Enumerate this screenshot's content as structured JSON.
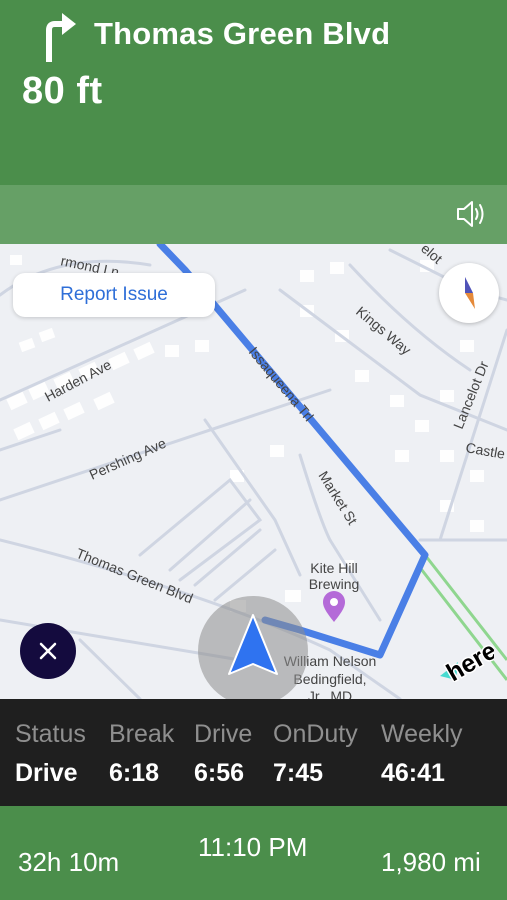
{
  "navigation": {
    "maneuver_icon": "turn-right-arrow-icon",
    "street_name": "Thomas Green Blvd",
    "distance": "80 ft"
  },
  "audio": {
    "icon": "speaker-icon"
  },
  "map": {
    "report_issue_label": "Report Issue",
    "compass_icon": "compass-icon",
    "close_icon": "close-icon",
    "logo_text": "here",
    "route_color": "#4a7fe6",
    "streets": {
      "ormond": "rmond Ln",
      "harden": "Harden Ave",
      "pershing": "Pershing Ave",
      "issaqueena": "Issaqueena Trl",
      "kings_way": "Kings Way",
      "lancelot": "Lancelot Dr",
      "castle": "Castle",
      "elot": "elot",
      "market": "Market St",
      "thomas_green": "Thomas Green Blvd"
    },
    "pois": [
      {
        "name_line1": "Kite Hill",
        "name_line2": "Brewing",
        "icon": "location-pin-icon"
      },
      {
        "name_line1": "William Nelson",
        "name_line2": "Bedingfield,",
        "name_line3": "Jr., MD"
      }
    ]
  },
  "status": {
    "columns": [
      {
        "header": "Status",
        "value": "Drive"
      },
      {
        "header": "Break",
        "value": "6:18"
      },
      {
        "header": "Drive",
        "value": "6:56"
      },
      {
        "header": "OnDuty",
        "value": "7:45"
      },
      {
        "header": "Weekly",
        "value": "46:41"
      }
    ]
  },
  "trip": {
    "elapsed": "32h 10m",
    "eta": "11:10 PM",
    "remaining_distance": "1,980 mi"
  },
  "colors": {
    "banner_green": "#4b8e4b",
    "secondary_green": "#66a066",
    "status_panel": "#1f1f1f",
    "close_button": "#140b3e",
    "link_blue": "#2f6fd8"
  }
}
